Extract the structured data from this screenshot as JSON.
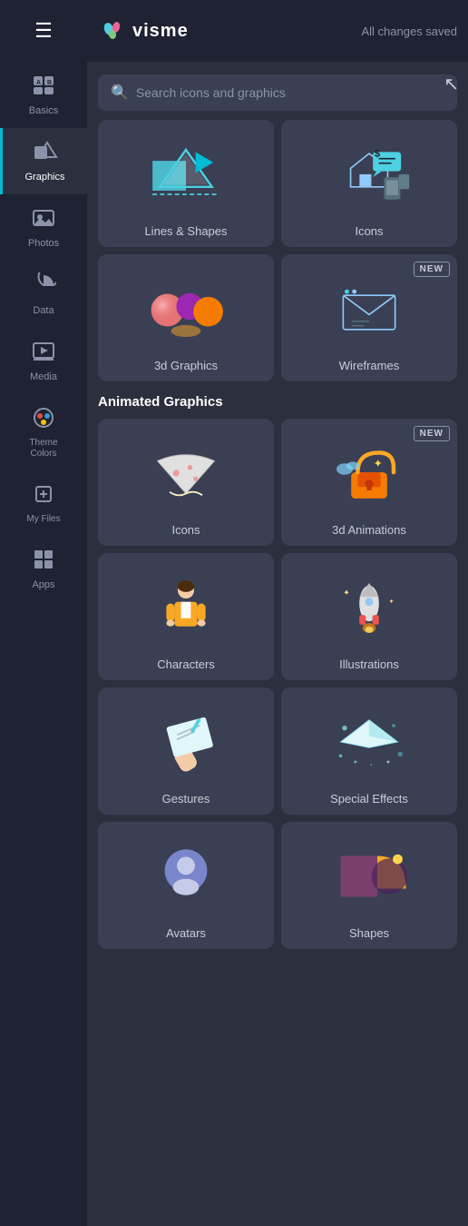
{
  "app": {
    "title": "visme",
    "status": "All changes saved",
    "logo_emoji": "🦎"
  },
  "search": {
    "placeholder": "Search icons and graphics"
  },
  "sidebar": {
    "items": [
      {
        "id": "basics",
        "label": "Basics",
        "icon": "🔤",
        "active": false
      },
      {
        "id": "graphics",
        "label": "Graphics",
        "icon": "🖼",
        "active": true
      },
      {
        "id": "photos",
        "label": "Photos",
        "icon": "📷",
        "active": false
      },
      {
        "id": "data",
        "label": "Data",
        "icon": "📊",
        "active": false
      },
      {
        "id": "media",
        "label": "Media",
        "icon": "▶",
        "active": false
      },
      {
        "id": "theme-colors",
        "label": "Theme Colors",
        "icon": "🎨",
        "active": false
      },
      {
        "id": "my-files",
        "label": "My Files",
        "icon": "➕",
        "active": false
      },
      {
        "id": "apps",
        "label": "Apps",
        "icon": "⊞",
        "active": false
      }
    ]
  },
  "static_section": {
    "cards": [
      {
        "id": "lines-shapes",
        "label": "Lines & Shapes",
        "new": false
      },
      {
        "id": "icons",
        "label": "Icons",
        "new": false
      },
      {
        "id": "3d-graphics",
        "label": "3d Graphics",
        "new": false
      },
      {
        "id": "wireframes",
        "label": "Wireframes",
        "new": true
      }
    ]
  },
  "animated_section": {
    "title": "Animated Graphics",
    "cards": [
      {
        "id": "anim-icons",
        "label": "Icons",
        "new": false
      },
      {
        "id": "3d-animations",
        "label": "3d Animations",
        "new": true
      },
      {
        "id": "characters",
        "label": "Characters",
        "new": false
      },
      {
        "id": "illustrations",
        "label": "Illustrations",
        "new": false
      },
      {
        "id": "gestures",
        "label": "Gestures",
        "new": false
      },
      {
        "id": "special-effects",
        "label": "Special Effects",
        "new": false
      },
      {
        "id": "avatars",
        "label": "Avatars",
        "new": false
      },
      {
        "id": "shapes",
        "label": "Shapes",
        "new": false
      }
    ]
  }
}
